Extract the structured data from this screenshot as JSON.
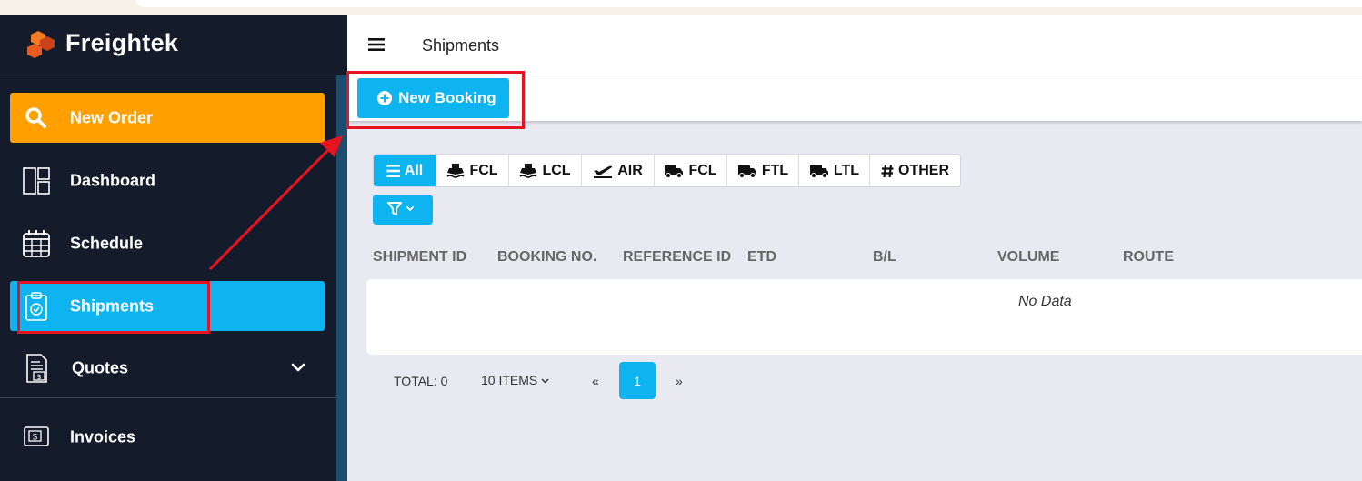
{
  "brand": {
    "name": "Freightek"
  },
  "sidebar": {
    "items": [
      {
        "label": "New Order",
        "icon": "search-icon"
      },
      {
        "label": "Dashboard",
        "icon": "dashboard-icon"
      },
      {
        "label": "Schedule",
        "icon": "calendar-icon"
      },
      {
        "label": "Shipments",
        "icon": "clipboard-check-icon"
      },
      {
        "label": "Quotes",
        "icon": "document-dollar-icon"
      },
      {
        "label": "Invoices",
        "icon": "invoice-dollar-icon"
      }
    ]
  },
  "header": {
    "title": "Shipments"
  },
  "actions": {
    "new_booking": "New Booking"
  },
  "filters": {
    "tabs": [
      {
        "label": "All",
        "icon": "list-icon"
      },
      {
        "label": "FCL",
        "icon": "ship-icon"
      },
      {
        "label": "LCL",
        "icon": "ship-icon"
      },
      {
        "label": "AIR",
        "icon": "plane-icon"
      },
      {
        "label": "FCL",
        "icon": "truck-icon"
      },
      {
        "label": "FTL",
        "icon": "truck-icon"
      },
      {
        "label": "LTL",
        "icon": "truck-icon"
      },
      {
        "label": "OTHER",
        "icon": "hash-icon"
      }
    ]
  },
  "table": {
    "columns": [
      "SHIPMENT ID",
      "BOOKING NO.",
      "REFERENCE ID",
      "ETD",
      "B/L",
      "VOLUME",
      "ROUTE"
    ],
    "empty_text": "No Data"
  },
  "pagination": {
    "total": "TOTAL: 0",
    "page_size": "10 ITEMS",
    "prev": "«",
    "current_page": "1",
    "next": "»"
  },
  "colors": {
    "sidebar_bg": "#141b2b",
    "accent_blue": "#0db4ef",
    "accent_orange": "#ff9f00",
    "annotation_red": "#e81320"
  }
}
